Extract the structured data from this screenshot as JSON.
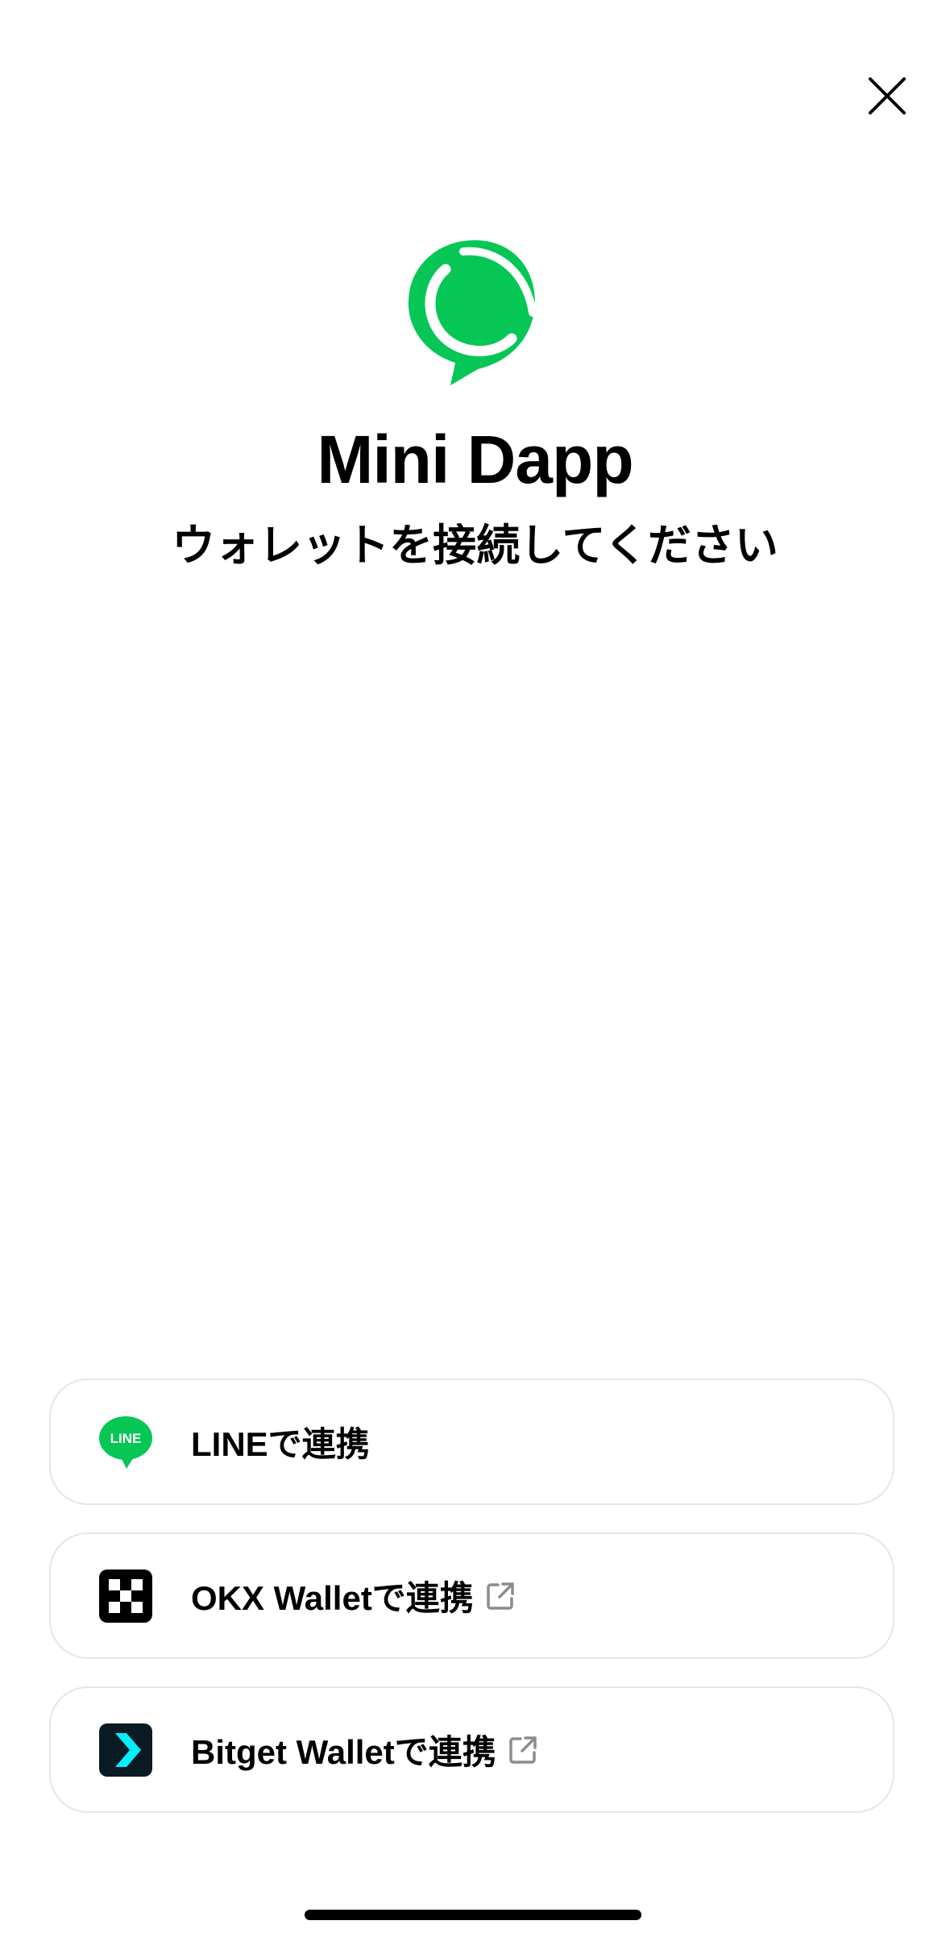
{
  "close_button": {
    "icon": "close-icon"
  },
  "app": {
    "logo_icon": "mini-dapp-logo",
    "title": "Mini Dapp",
    "subtitle": "ウォレットを接続してください"
  },
  "wallet_options": [
    {
      "label": "LINEで連携",
      "icon": "line-icon",
      "logo_text": "LINE",
      "external": false
    },
    {
      "label": "OKX Walletで連携",
      "icon": "okx-icon",
      "external": true
    },
    {
      "label": "Bitget Walletで連携",
      "icon": "bitget-icon",
      "external": true
    }
  ],
  "colors": {
    "brand_green": "#06C755",
    "text": "#000000",
    "button_border": "#E6E6E6",
    "external_icon": "#8C8C8C",
    "okx_bg": "#000000",
    "bitget_bg": "#0B1B26",
    "bitget_accent": "#00F0FF"
  }
}
